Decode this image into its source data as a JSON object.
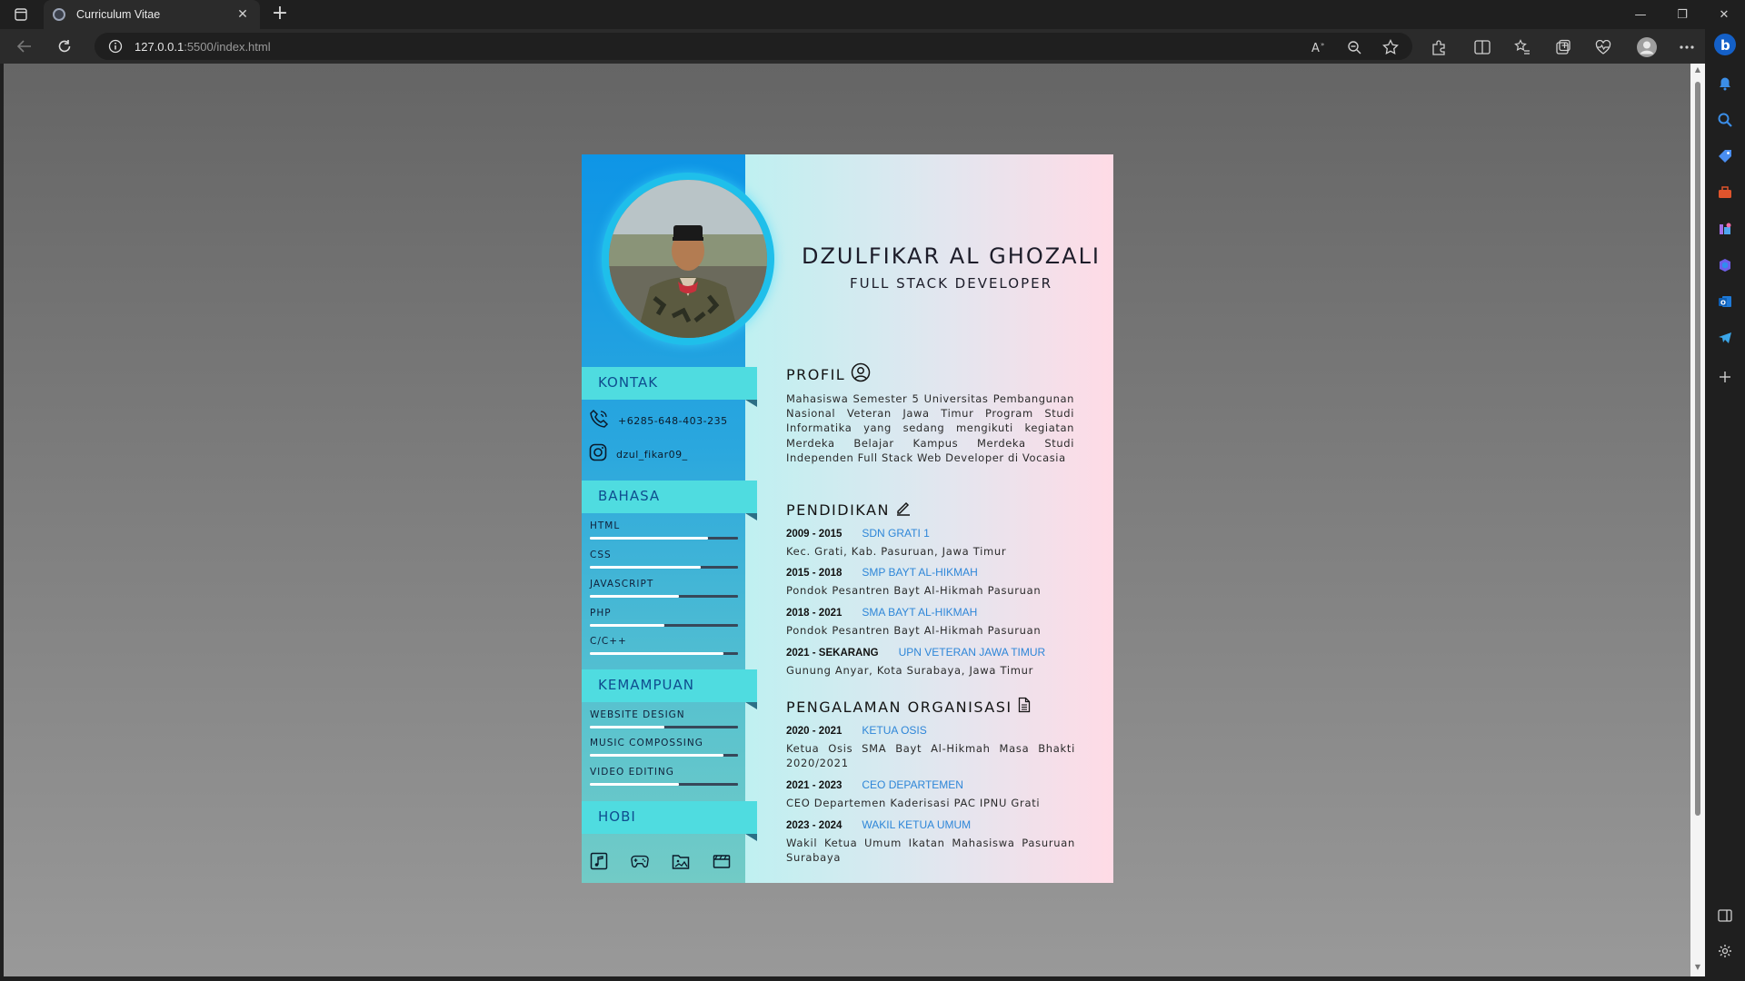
{
  "browser": {
    "tab_title": "Curriculum Vitae",
    "new_tab_label": "+",
    "url_host": "127.0.0.1",
    "url_rest": ":5500/index.html",
    "minimize": "—",
    "maximize": "❐",
    "close": "✕"
  },
  "cv": {
    "name": "DZULFIKAR AL GHOZALI",
    "role": "FULL STACK DEVELOPER",
    "left": {
      "kontak_title": "KONTAK",
      "phone": "+6285-648-403-235",
      "instagram": "dzul_fikar09_",
      "bahasa_title": "BAHASA",
      "bahasa": [
        {
          "label": "HTML",
          "level": 0.8
        },
        {
          "label": "CSS",
          "level": 0.75
        },
        {
          "label": "JAVASCRIPT",
          "level": 0.6
        },
        {
          "label": "PHP",
          "level": 0.5
        },
        {
          "label": "C/C++",
          "level": 0.9
        }
      ],
      "kemampuan_title": "KEMAMPUAN",
      "kemampuan": [
        {
          "label": "WEBSITE DESIGN",
          "level": 0.5
        },
        {
          "label": "MUSIC COMPOSSING",
          "level": 0.9
        },
        {
          "label": "VIDEO EDITING",
          "level": 0.6
        }
      ],
      "hobi_title": "HOBI",
      "hobi_icons": [
        "music-note-icon",
        "gamepad-icon",
        "folder-image-icon",
        "film-icon"
      ]
    },
    "profil_title": "PROFIL",
    "profil_text": "Mahasiswa Semester 5 Universitas Pembangunan Nasional Veteran Jawa Timur Program Studi Informatika yang sedang mengikuti kegiatan Merdeka Belajar Kampus Merdeka Studi Independen Full Stack Web Developer di Vocasia",
    "pendidikan_title": "PENDIDIKAN",
    "pendidikan": [
      {
        "years": "2009 - 2015",
        "institution": "SDN GRATI 1",
        "desc": "Kec. Grati, Kab. Pasuruan, Jawa Timur"
      },
      {
        "years": "2015 - 2018",
        "institution": "SMP BAYT AL-HIKMAH",
        "desc": "Pondok Pesantren Bayt Al-Hikmah Pasuruan"
      },
      {
        "years": "2018 - 2021",
        "institution": "SMA BAYT AL-HIKMAH",
        "desc": "Pondok Pesantren Bayt Al-Hikmah Pasuruan"
      },
      {
        "years": "2021 - SEKARANG",
        "institution": "UPN VETERAN JAWA TIMUR",
        "desc": "Gunung Anyar, Kota Surabaya, Jawa Timur"
      }
    ],
    "organisasi_title": "PENGALAMAN ORGANISASI",
    "organisasi": [
      {
        "years": "2020 - 2021",
        "institution": "KETUA OSIS",
        "desc": "Ketua Osis SMA Bayt Al-Hikmah Masa Bhakti 2020/2021"
      },
      {
        "years": "2021 - 2023",
        "institution": "CEO DEPARTEMEN",
        "desc": "CEO Departemen Kaderisasi PAC IPNU Grati"
      },
      {
        "years": "2023 - 2024",
        "institution": "WAKIL KETUA UMUM",
        "desc": "Wakil Ketua Umum Ikatan Mahasiswa Pasuruan Surabaya"
      }
    ]
  }
}
